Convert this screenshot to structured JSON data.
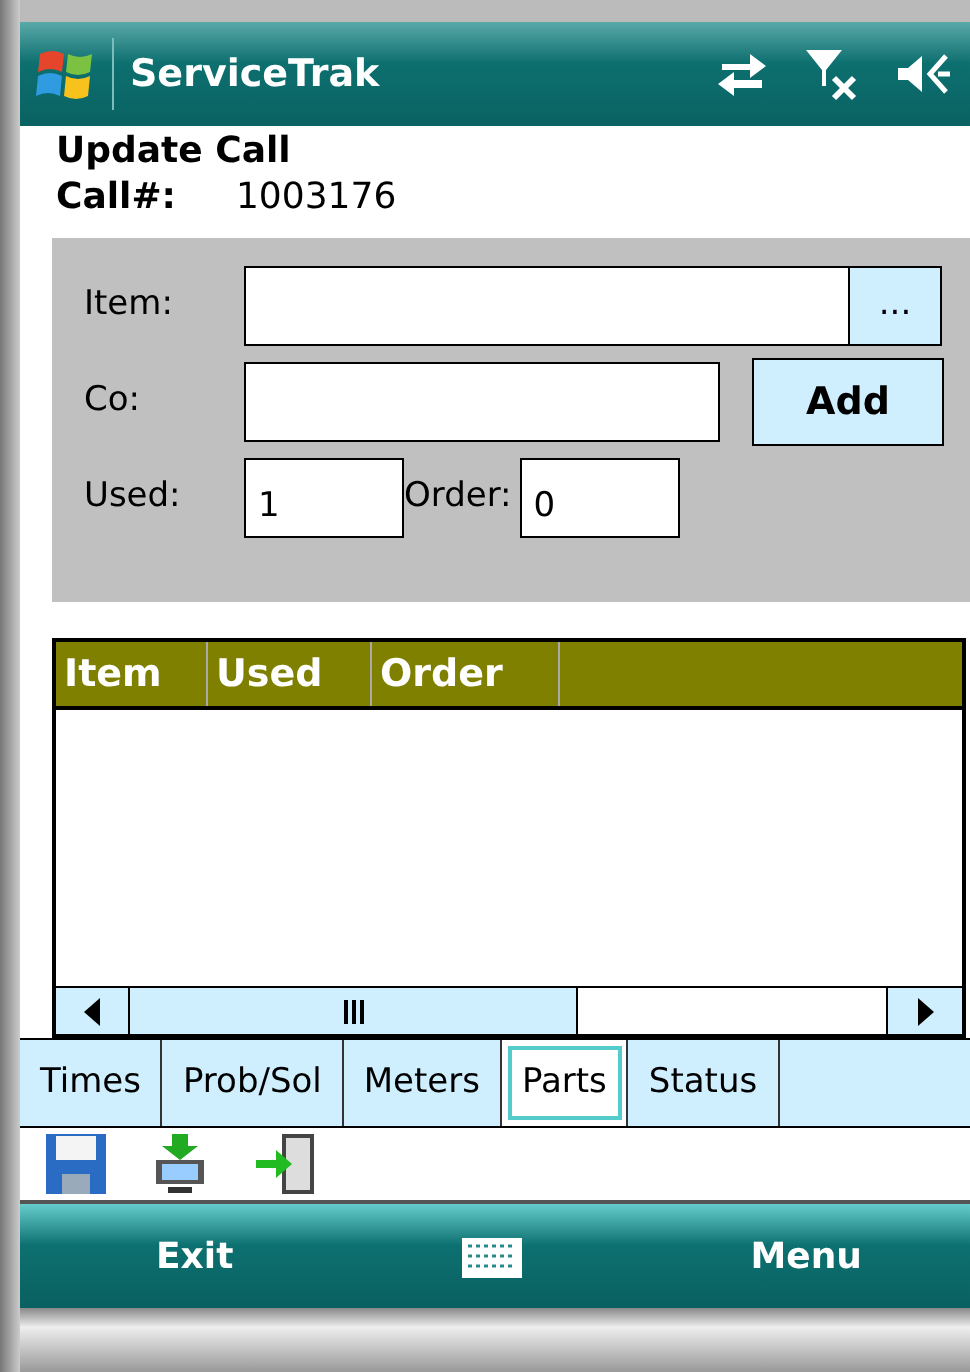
{
  "window": {
    "title": "ServiceTrak"
  },
  "heading": "Update Call",
  "call": {
    "label": "Call#:",
    "value": "1003176"
  },
  "form": {
    "item_label": "Item:",
    "browse_button": "...",
    "co_label": "Co:",
    "add_button": "Add",
    "used_label": "Used:",
    "used_value": "1",
    "order_label": "Order:",
    "order_value": "0"
  },
  "grid": {
    "columns": [
      "Item",
      "Used",
      "Order"
    ]
  },
  "tabs": [
    {
      "label": "Times",
      "selected": false
    },
    {
      "label": "Prob/Sol",
      "selected": false
    },
    {
      "label": "Meters",
      "selected": false
    },
    {
      "label": "Parts",
      "selected": true
    },
    {
      "label": "Status",
      "selected": false
    }
  ],
  "softkeys": {
    "left": "Exit",
    "right": "Menu"
  }
}
